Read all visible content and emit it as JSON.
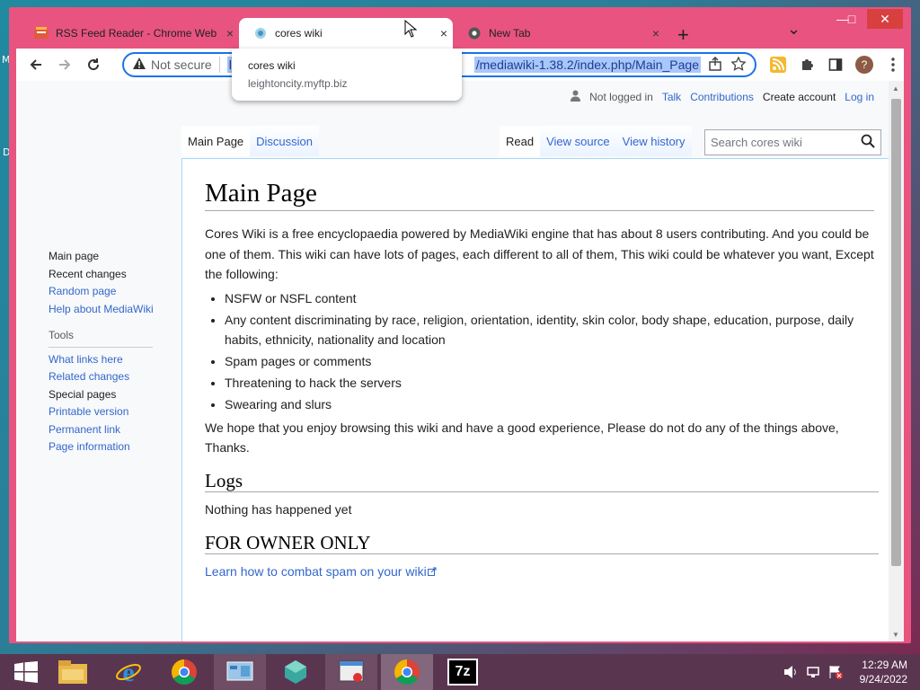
{
  "desktop": {
    "labels": [
      "M",
      "D"
    ]
  },
  "browser": {
    "tabs": [
      {
        "title": "RSS Feed Reader - Chrome Web",
        "close": "×"
      },
      {
        "title": "cores wiki",
        "close": "×"
      },
      {
        "title": "New Tab",
        "close": "×"
      }
    ],
    "new_tab": "+",
    "tab_search": "⌄",
    "window_controls": {
      "minimize": "—",
      "maximize": "□",
      "close": "✕"
    },
    "omnibox": {
      "security": "Not secure",
      "url_visible_start": "lei",
      "url_visible_end": "/mediawiki-1.38.2/index.php/Main_Page"
    },
    "profile_initial": "?",
    "tab_hover_card": {
      "title": "cores wiki",
      "domain": "leightoncity.myftp.biz"
    }
  },
  "wiki": {
    "user_nav": {
      "status": "Not logged in",
      "links": [
        "Talk",
        "Contributions",
        "Create account",
        "Log in"
      ]
    },
    "namespace_tabs": [
      "Main Page",
      "Discussion"
    ],
    "view_tabs": [
      "Read",
      "View source",
      "View history"
    ],
    "search_placeholder": "Search cores wiki",
    "sidebar": {
      "navigation": [
        "Main page",
        "Recent changes",
        "Random page",
        "Help about MediaWiki"
      ],
      "tools_header": "Tools",
      "tools": [
        "What links here",
        "Related changes",
        "Special pages",
        "Printable version",
        "Permanent link",
        "Page information"
      ]
    },
    "page_title": "Main Page",
    "intro": "Cores Wiki is a free encyclopaedia powered by MediaWiki engine that has about 8 users contributing. And you could be one of them. This wiki can have lots of pages, each different to all of them, This wiki could be whatever you want, Except the following:",
    "rules": [
      "NSFW or NSFL content",
      "Any content discriminating by race, religion, orientation, identity, skin color, body shape, education, purpose, daily habits, ethnicity, nationality and location",
      "Spam pages or comments",
      "Threatening to hack the servers",
      "Swearing and slurs"
    ],
    "closing": "We hope that you enjoy browsing this wiki and have a good experience, Please do not do any of the things above, Thanks.",
    "logs_heading": "Logs",
    "logs_text": "Nothing has happened yet",
    "owner_heading": "FOR OWNER ONLY",
    "owner_link": "Learn how to combat spam on your wiki"
  },
  "taskbar": {
    "clock_time": "12:29 AM",
    "clock_date": "9/24/2022",
    "sevenzip_label": "7z"
  },
  "colors": {
    "window_frame": "#e8547f",
    "link": "#3366cc",
    "omnibox_focus": "#1a73e8",
    "taskbar": "#5a3550"
  }
}
